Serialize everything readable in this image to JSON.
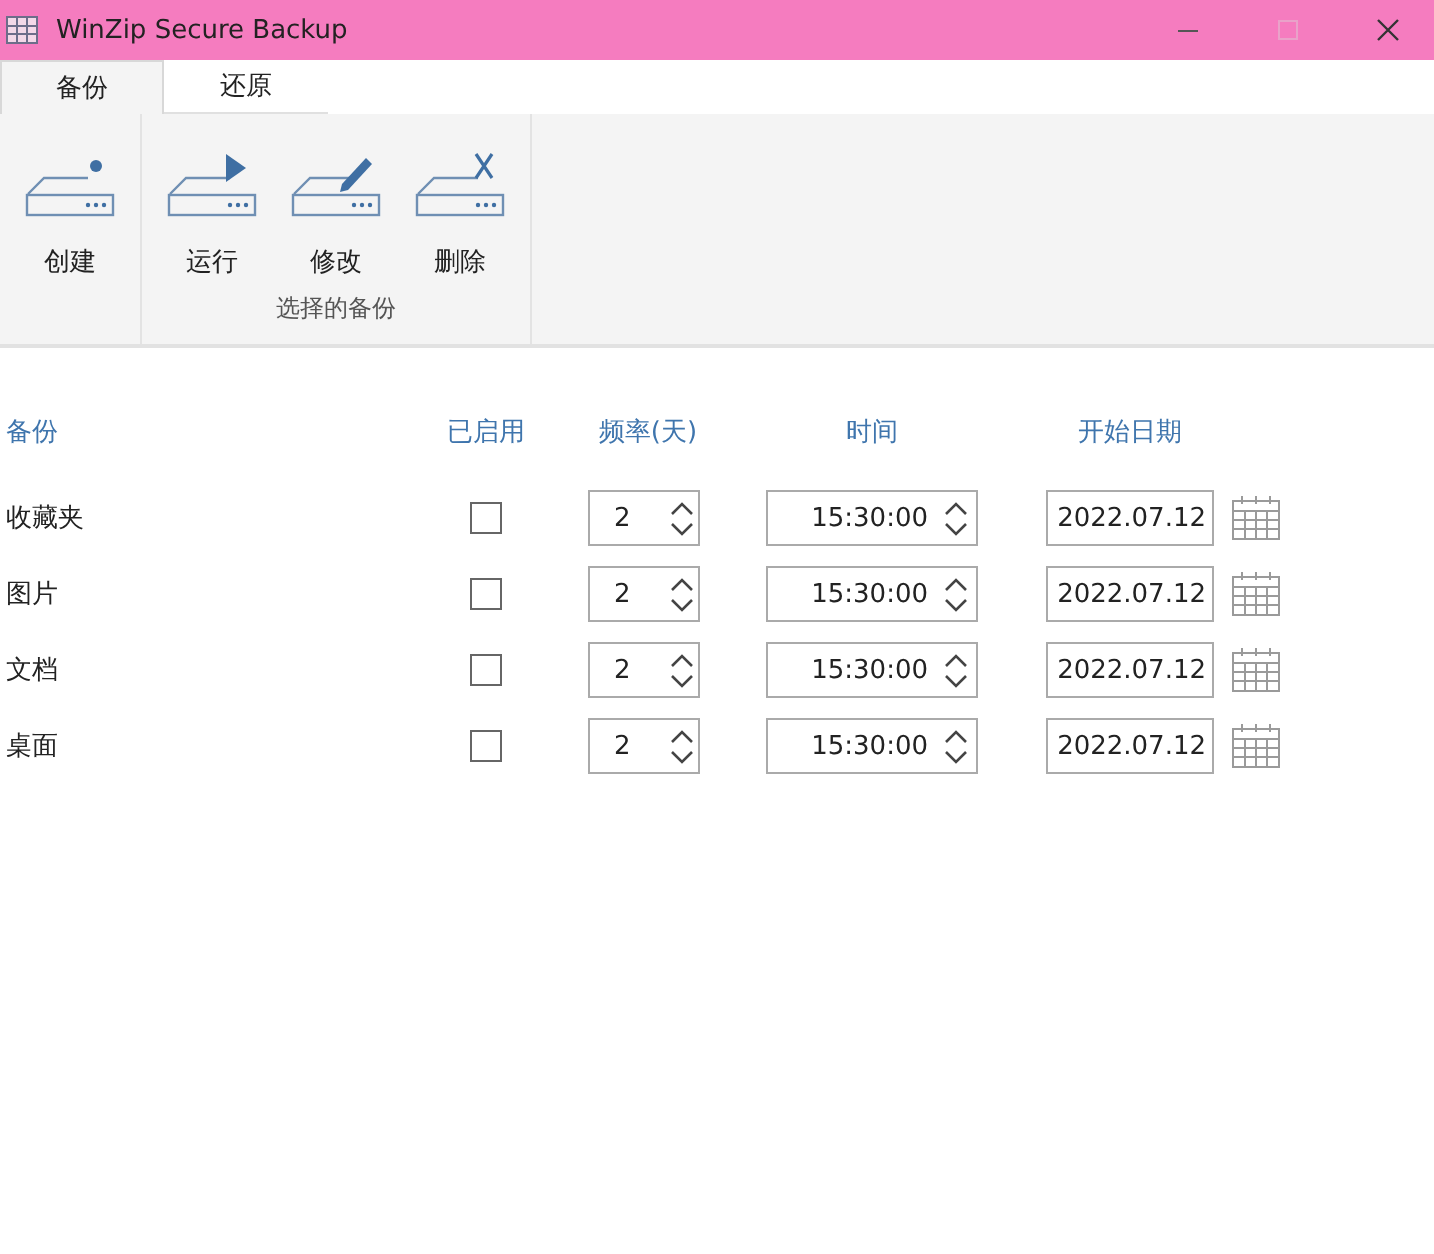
{
  "window": {
    "title": "WinZip Secure Backup"
  },
  "tabs": [
    {
      "label": "备份",
      "selected": true
    },
    {
      "label": "还原",
      "selected": false
    }
  ],
  "ribbon": {
    "groups": [
      {
        "buttons": [
          {
            "label": "创建",
            "kind": "create"
          }
        ]
      },
      {
        "label": "选择的备份",
        "buttons": [
          {
            "label": "运行",
            "kind": "run"
          },
          {
            "label": "修改",
            "kind": "edit"
          },
          {
            "label": "删除",
            "kind": "delete"
          }
        ]
      }
    ]
  },
  "table": {
    "columns": [
      "备份",
      "已启用",
      "频率(天)",
      "时间",
      "开始日期"
    ],
    "rows": [
      {
        "name": "收藏夹",
        "enabled": false,
        "frequency": "2",
        "time": "15:30:00",
        "start_date": "2022.07.12"
      },
      {
        "name": "图片",
        "enabled": false,
        "frequency": "2",
        "time": "15:30:00",
        "start_date": "2022.07.12"
      },
      {
        "name": "文档",
        "enabled": false,
        "frequency": "2",
        "time": "15:30:00",
        "start_date": "2022.07.12"
      },
      {
        "name": "桌面",
        "enabled": false,
        "frequency": "2",
        "time": "15:30:00",
        "start_date": "2022.07.12"
      }
    ]
  }
}
